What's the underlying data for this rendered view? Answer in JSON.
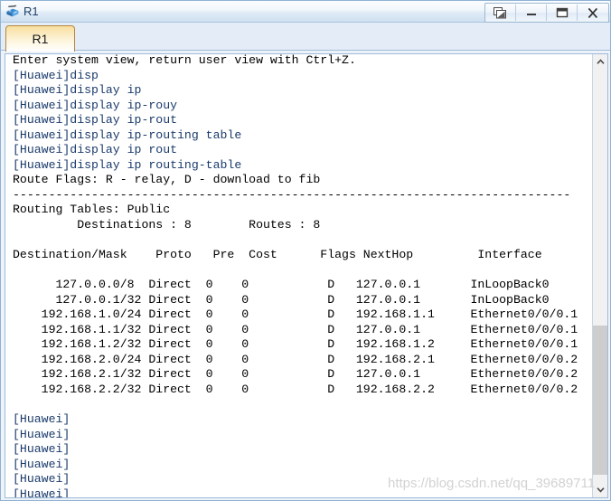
{
  "window": {
    "title": "R1",
    "icon": "router-icon",
    "buttons": [
      {
        "name": "restore-windows-button",
        "label": "Restore",
        "icon": "cascade-windows-icon"
      },
      {
        "name": "minimize-button",
        "label": "Minimize",
        "icon": "minimize-icon"
      },
      {
        "name": "maximize-button",
        "label": "Maximize",
        "icon": "maximize-icon"
      },
      {
        "name": "close-button",
        "label": "X",
        "icon": "close-icon"
      }
    ]
  },
  "tabs": [
    {
      "label": "R1",
      "active": true
    }
  ],
  "terminal": {
    "lines": [
      {
        "text": "Enter system view, return user view with Ctrl+Z.",
        "kind": "output"
      },
      {
        "text": "[Huawei]disp",
        "kind": "prompt"
      },
      {
        "text": "[Huawei]display ip",
        "kind": "prompt"
      },
      {
        "text": "[Huawei]display ip-rouy",
        "kind": "prompt"
      },
      {
        "text": "[Huawei]display ip-rout",
        "kind": "prompt"
      },
      {
        "text": "[Huawei]display ip-routing table",
        "kind": "prompt"
      },
      {
        "text": "[Huawei]display ip rout",
        "kind": "prompt"
      },
      {
        "text": "[Huawei]display ip routing-table",
        "kind": "prompt"
      },
      {
        "text": "Route Flags: R - relay, D - download to fib",
        "kind": "output"
      },
      {
        "text": "------------------------------------------------------------------------------",
        "kind": "output"
      },
      {
        "text": "Routing Tables: Public",
        "kind": "output"
      },
      {
        "text": "         Destinations : 8        Routes : 8",
        "kind": "output"
      },
      {
        "text": "",
        "kind": "output"
      },
      {
        "text": "Destination/Mask    Proto   Pre  Cost      Flags NextHop         Interface",
        "kind": "output"
      },
      {
        "text": "",
        "kind": "output"
      },
      {
        "text": "      127.0.0.0/8  Direct  0    0           D   127.0.0.1       InLoopBack0",
        "kind": "output"
      },
      {
        "text": "      127.0.0.1/32 Direct  0    0           D   127.0.0.1       InLoopBack0",
        "kind": "output"
      },
      {
        "text": "    192.168.1.0/24 Direct  0    0           D   192.168.1.1     Ethernet0/0/0.1",
        "kind": "output"
      },
      {
        "text": "    192.168.1.1/32 Direct  0    0           D   127.0.0.1       Ethernet0/0/0.1",
        "kind": "output"
      },
      {
        "text": "    192.168.1.2/32 Direct  0    0           D   192.168.1.2     Ethernet0/0/0.1",
        "kind": "output"
      },
      {
        "text": "    192.168.2.0/24 Direct  0    0           D   192.168.2.1     Ethernet0/0/0.2",
        "kind": "output"
      },
      {
        "text": "    192.168.2.1/32 Direct  0    0           D   127.0.0.1       Ethernet0/0/0.2",
        "kind": "output"
      },
      {
        "text": "    192.168.2.2/32 Direct  0    0           D   192.168.2.2     Ethernet0/0/0.2",
        "kind": "output"
      },
      {
        "text": "",
        "kind": "output"
      },
      {
        "text": "[Huawei]",
        "kind": "prompt"
      },
      {
        "text": "[Huawei]",
        "kind": "prompt"
      },
      {
        "text": "[Huawei]",
        "kind": "prompt"
      },
      {
        "text": "[Huawei]",
        "kind": "prompt"
      },
      {
        "text": "[Huawei]",
        "kind": "prompt"
      },
      {
        "text": "[Huawei]",
        "kind": "prompt"
      }
    ],
    "routing_table": {
      "flags_legend": "Route Flags: R - relay, D - download to fib",
      "table_name": "Routing Tables: Public",
      "destinations": 8,
      "routes": 8,
      "columns": [
        "Destination/Mask",
        "Proto",
        "Pre",
        "Cost",
        "Flags",
        "NextHop",
        "Interface"
      ],
      "rows": [
        [
          "127.0.0.0/8",
          "Direct",
          "0",
          "0",
          "D",
          "127.0.0.1",
          "InLoopBack0"
        ],
        [
          "127.0.0.1/32",
          "Direct",
          "0",
          "0",
          "D",
          "127.0.0.1",
          "InLoopBack0"
        ],
        [
          "192.168.1.0/24",
          "Direct",
          "0",
          "0",
          "D",
          "192.168.1.1",
          "Ethernet0/0/0.1"
        ],
        [
          "192.168.1.1/32",
          "Direct",
          "0",
          "0",
          "D",
          "127.0.0.1",
          "Ethernet0/0/0.1"
        ],
        [
          "192.168.1.2/32",
          "Direct",
          "0",
          "0",
          "D",
          "192.168.1.2",
          "Ethernet0/0/0.1"
        ],
        [
          "192.168.2.0/24",
          "Direct",
          "0",
          "0",
          "D",
          "192.168.2.1",
          "Ethernet0/0/0.2"
        ],
        [
          "192.168.2.1/32",
          "Direct",
          "0",
          "0",
          "D",
          "127.0.0.1",
          "Ethernet0/0/0.2"
        ],
        [
          "192.168.2.2/32",
          "Direct",
          "0",
          "0",
          "D",
          "192.168.2.2",
          "Ethernet0/0/0.2"
        ]
      ]
    }
  },
  "scrollbar": {
    "up_arrow": "chevron-up-icon",
    "down_arrow": "chevron-down-icon"
  },
  "watermark": {
    "text": "https://blog.csdn.net/qq_39689711"
  },
  "colors": {
    "prompt_text": "#1a3a6b",
    "output_text": "#000000",
    "tab_accent": "#f8dfa0",
    "window_border": "#8fb2d4",
    "terminal_bg": "#ffffff"
  }
}
